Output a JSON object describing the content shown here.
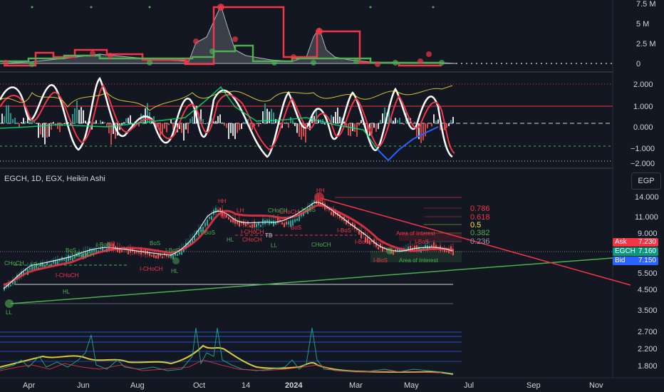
{
  "symbol_title": "EGCH, 1D, EGX, Heikin Ashi",
  "currency_label": "EGP",
  "price_tags": [
    {
      "label": "Ask",
      "value": "7.230",
      "color": "#f23645"
    },
    {
      "label": "EGCH",
      "value": "7.160",
      "color": "#089981"
    },
    {
      "label": "Bid",
      "value": "7.150",
      "color": "#2962ff"
    }
  ],
  "volume_axis": [
    "7.5 M",
    "5 M",
    "2.5 M",
    "0"
  ],
  "osc_axis": [
    "2.000",
    "1.000",
    "0.000",
    "−1.000",
    "−2.000"
  ],
  "price_axis": [
    "14.000",
    "11.000",
    "9.000",
    "5.500",
    "4.500",
    "3.500",
    "2.700",
    "2.200",
    "1.800"
  ],
  "time_axis": [
    "Apr",
    "Jun",
    "Aug",
    "Oct",
    "14",
    "2024",
    "Mar",
    "May",
    "Jul",
    "Sep",
    "Nov"
  ],
  "fib_levels": [
    {
      "value": "0.786",
      "color": "#f23645"
    },
    {
      "value": "0.618",
      "color": "#f23645"
    },
    {
      "value": "0.5",
      "color": "#ffeb3b"
    },
    {
      "value": "0.382",
      "color": "#4caf50"
    },
    {
      "value": "0.236",
      "color": "#9598a1"
    }
  ],
  "structure_labels": [
    {
      "text": "HH",
      "color": "#f23645"
    },
    {
      "text": "LH",
      "color": "#f23645"
    },
    {
      "text": "HH",
      "color": "#f23645"
    },
    {
      "text": "HH",
      "color": "#f23645"
    },
    {
      "text": "HL",
      "color": "#4caf50"
    },
    {
      "text": "HL",
      "color": "#4caf50"
    },
    {
      "text": "HL",
      "color": "#4caf50"
    },
    {
      "text": "LL",
      "color": "#4caf50"
    },
    {
      "text": "TB",
      "color": "#d1d4dc"
    },
    {
      "text": "LL",
      "color": "#4caf50"
    },
    {
      "text": "BoS",
      "color": "#4caf50"
    },
    {
      "text": "BoS",
      "color": "#4caf50"
    },
    {
      "text": "I-BoS",
      "color": "#4caf50"
    },
    {
      "text": "I-BoS",
      "color": "#4caf50"
    },
    {
      "text": "CHoCH",
      "color": "#f23645"
    },
    {
      "text": "CHoCH",
      "color": "#f23645"
    },
    {
      "text": "I-CHoCH",
      "color": "#f23645"
    },
    {
      "text": "I-CHoCH",
      "color": "#4caf50"
    },
    {
      "text": "I-CHoCH",
      "color": "#f23645"
    },
    {
      "text": "I-CHoCH",
      "color": "#f23645"
    },
    {
      "text": "CHoCH",
      "color": "#4caf50"
    },
    {
      "text": "I-BoS",
      "color": "#f23645"
    },
    {
      "text": "BoS",
      "color": "#f23645"
    },
    {
      "text": "CHoCH",
      "color": "#4caf50"
    },
    {
      "text": "I-BoS",
      "color": "#f23645"
    },
    {
      "text": "I-BoS",
      "color": "#f23645"
    },
    {
      "text": "I-BoS",
      "color": "#4caf50"
    },
    {
      "text": "I-BoS",
      "color": "#4caf50"
    },
    {
      "text": "I-BoS",
      "color": "#4caf50"
    },
    {
      "text": "I-BoS",
      "color": "#f23645"
    },
    {
      "text": "Area of Interest",
      "color": "#4caf50"
    },
    {
      "text": "Area of Interest",
      "color": "#f23645"
    },
    {
      "text": "CHoCH",
      "color": "#4caf50"
    }
  ]
}
